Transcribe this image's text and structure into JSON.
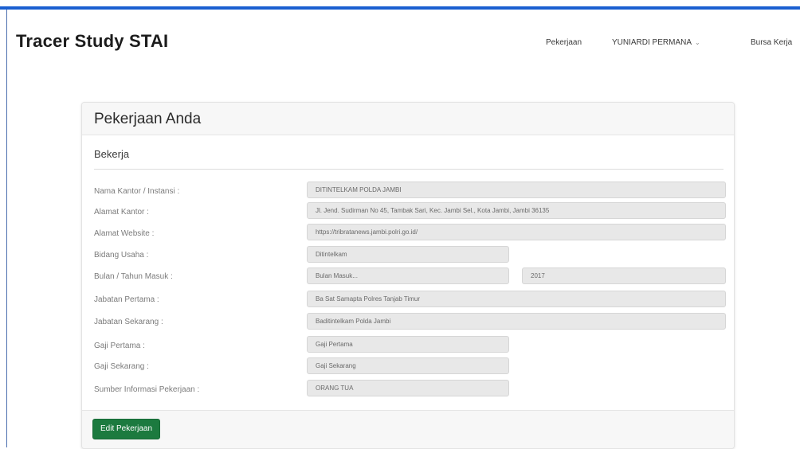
{
  "brand": "Tracer Study STAI",
  "nav": {
    "pekerjaan": "Pekerjaan",
    "user": "YUNIARDI PERMANA",
    "bursa": "Bursa Kerja"
  },
  "card": {
    "title": "Pekerjaan Anda",
    "section": "Bekerja",
    "fields": [
      {
        "label": "Nama Kantor / Instansi :",
        "value": "DITINTELKAM POLDA JAMBI"
      },
      {
        "label": "Alamat Kantor :",
        "value": "Jl. Jend. Sudirman No 45, Tambak Sari, Kec. Jambi Sel., Kota Jambi, Jambi 36135"
      },
      {
        "label": "Alamat Website :",
        "value": "https://tribratanews.jambi.polri.go.id/"
      },
      {
        "label": "Bidang Usaha :",
        "value": "Ditintelkam"
      },
      {
        "label": "Bulan / Tahun Masuk :",
        "value": "Bulan Masuk...",
        "value2": "2017"
      },
      {
        "label": "Jabatan Pertama :",
        "value": "Ba Sat Samapta Polres Tanjab Timur"
      },
      {
        "label": "Jabatan Sekarang :",
        "value": "Baditintelkam Polda Jambi"
      },
      {
        "label": "Gaji Pertama :",
        "value": "Gaji Pertama"
      },
      {
        "label": "Gaji Sekarang :",
        "value": "Gaji Sekarang"
      },
      {
        "label": "Sumber Informasi Pekerjaan :",
        "value": "ORANG TUA"
      }
    ],
    "edit_button": "Edit Pekerjaan"
  },
  "colors": {
    "accent_bar": "#1a5fd1",
    "button": "#1c7a3f"
  }
}
